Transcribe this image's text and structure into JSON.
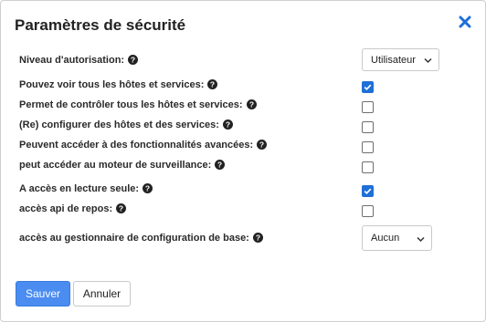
{
  "dialog": {
    "title": "Paramètres de sécurité",
    "close_icon": "close-icon"
  },
  "fields": {
    "auth_level": {
      "label": "Niveau d'autorisation:",
      "value": "Utilisateur"
    },
    "view_all": {
      "label": "Pouvez voir tous les hôtes et services:",
      "checked": true
    },
    "control_all": {
      "label": "Permet de contrôler tous les hôtes et services:",
      "checked": false
    },
    "reconfigure": {
      "label": "(Re) configurer des hôtes et des services:",
      "checked": false
    },
    "advanced": {
      "label": "Peuvent accéder à des fonctionnalités avancées:",
      "checked": false
    },
    "monitoring_engine": {
      "label": "peut accéder au moteur de surveillance:",
      "checked": false
    },
    "read_only": {
      "label": "A accès en lecture seule:",
      "checked": true
    },
    "rest_api": {
      "label": "accès api de repos:",
      "checked": false
    },
    "config_manager": {
      "label": "accès au gestionnaire de configuration de base:",
      "value": "Aucun"
    }
  },
  "footer": {
    "save_label": "Sauver",
    "cancel_label": "Annuler"
  },
  "colors": {
    "primary": "#4a8cf0",
    "checkbox_checked": "#1f6fd6",
    "close_icon": "#1f6fd6"
  }
}
